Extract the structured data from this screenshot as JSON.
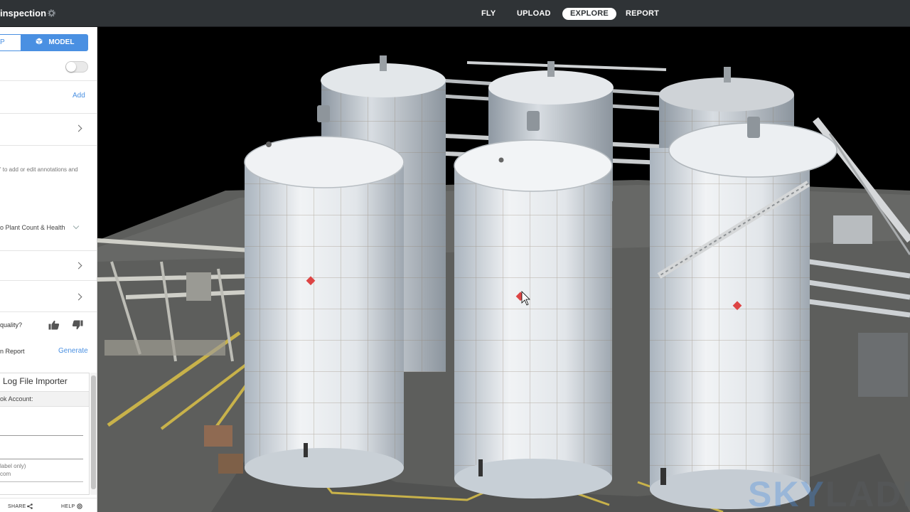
{
  "header": {
    "project_title": "inspection",
    "nav": [
      "FLY",
      "UPLOAD",
      "EXPLORE",
      "REPORT"
    ],
    "active_nav": "EXPLORE"
  },
  "sidebar": {
    "view_toggle": {
      "left_label": "P",
      "model_label": "MODEL"
    },
    "add_label": "Add",
    "annotation_hint": "' to add or edit annotations and",
    "plant_dropdown": "o Plant Count & Health",
    "quality_question": "quality?",
    "report_label": "n Report",
    "generate_label": "Generate",
    "importer": {
      "title": "Log File Importer",
      "account_label": "ok Account:",
      "hint_line1": "label only)",
      "hint_line2": "com"
    },
    "footer": {
      "share": "SHARE",
      "help": "HELP"
    }
  },
  "viewport": {
    "watermark_part1": "SKY",
    "watermark_part2": "LADDER"
  },
  "colors": {
    "accent": "#4a90e2",
    "topbar": "#2f3336",
    "watermark_blue": "#4a90e2"
  }
}
